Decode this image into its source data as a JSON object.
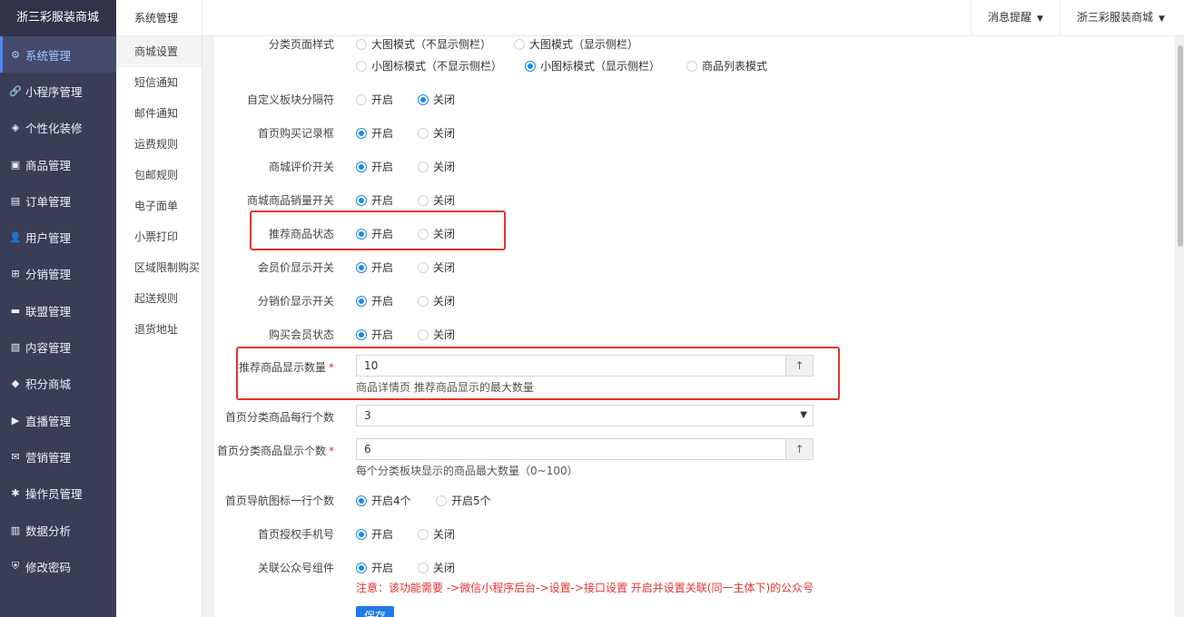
{
  "brand": "浙三彩服装商城",
  "nav": [
    {
      "label": "系统管理",
      "icon": "gear-icon",
      "glyph": "⚙"
    },
    {
      "label": "小程序管理",
      "icon": "link-icon",
      "glyph": "🔗"
    },
    {
      "label": "个性化装修",
      "icon": "diamond-icon",
      "glyph": "◈"
    },
    {
      "label": "商品管理",
      "icon": "bag-icon",
      "glyph": "▣"
    },
    {
      "label": "订单管理",
      "icon": "list-icon",
      "glyph": "▤"
    },
    {
      "label": "用户管理",
      "icon": "user-icon",
      "glyph": "👤"
    },
    {
      "label": "分销管理",
      "icon": "sitemap-icon",
      "glyph": "⊞"
    },
    {
      "label": "联盟管理",
      "icon": "card-icon",
      "glyph": "▬"
    },
    {
      "label": "内容管理",
      "icon": "doc-icon",
      "glyph": "▧"
    },
    {
      "label": "积分商城",
      "icon": "box-icon",
      "glyph": "◆"
    },
    {
      "label": "直播管理",
      "icon": "play-icon",
      "glyph": "▶"
    },
    {
      "label": "营销管理",
      "icon": "gift-icon",
      "glyph": "✉"
    },
    {
      "label": "操作员管理",
      "icon": "cog-icon",
      "glyph": "✱"
    },
    {
      "label": "数据分析",
      "icon": "bar-chart-icon",
      "glyph": "▥"
    },
    {
      "label": "修改密码",
      "icon": "shield-icon",
      "glyph": "⛨"
    }
  ],
  "subnav": {
    "title": "系统管理",
    "items": [
      "商城设置",
      "短信通知",
      "邮件通知",
      "运费规则",
      "包邮规则",
      "电子面单",
      "小票打印",
      "区域限制购买",
      "起送规则",
      "退货地址"
    ]
  },
  "topbar": {
    "notice": "消息提醒",
    "shop": "浙三彩服装商城"
  },
  "form": {
    "category_style": {
      "label": "分类页面样式",
      "options": [
        "大图模式（不显示侧栏）",
        "大图模式（显示侧栏）",
        "小图标模式（不显示侧栏）",
        "小图标模式（显示侧栏）",
        "商品列表模式"
      ],
      "selected": "小图标模式（显示侧栏）"
    },
    "on": "开启",
    "off": "关闭",
    "toggles": [
      {
        "label": "自定义板块分隔符",
        "value": "关闭"
      },
      {
        "label": "首页购买记录框",
        "value": "开启"
      },
      {
        "label": "商城评价开关",
        "value": "开启"
      },
      {
        "label": "商城商品销量开关",
        "value": "开启"
      },
      {
        "label": "推荐商品状态",
        "value": "开启"
      },
      {
        "label": "会员价显示开关",
        "value": "开启"
      },
      {
        "label": "分销价显示开关",
        "value": "开启"
      },
      {
        "label": "购买会员状态",
        "value": "开启"
      }
    ],
    "rec_count": {
      "label": "推荐商品显示数量",
      "value": "10",
      "help": "商品详情页 推荐商品显示的最大数量",
      "required": "*"
    },
    "per_row": {
      "label": "首页分类商品每行个数",
      "value": "3"
    },
    "cat_count": {
      "label": "首页分类商品显示个数",
      "value": "6",
      "help": "每个分类板块显示的商品最大数量（0~100）",
      "required": "*"
    },
    "nav_per_row": {
      "label": "首页导航图标一行个数",
      "options": [
        "开启4个",
        "开启5个"
      ],
      "selected": "开启4个"
    },
    "auth_phone": {
      "label": "首页授权手机号",
      "value": "开启"
    },
    "mp_component": {
      "label": "关联公众号组件",
      "value": "开启",
      "warning": "注意：该功能需要 ->微信小程序后台->设置->接口设置 开启并设置关联(同一主体下)的公众号"
    },
    "save": "保存",
    "spin_glyph": "个"
  }
}
